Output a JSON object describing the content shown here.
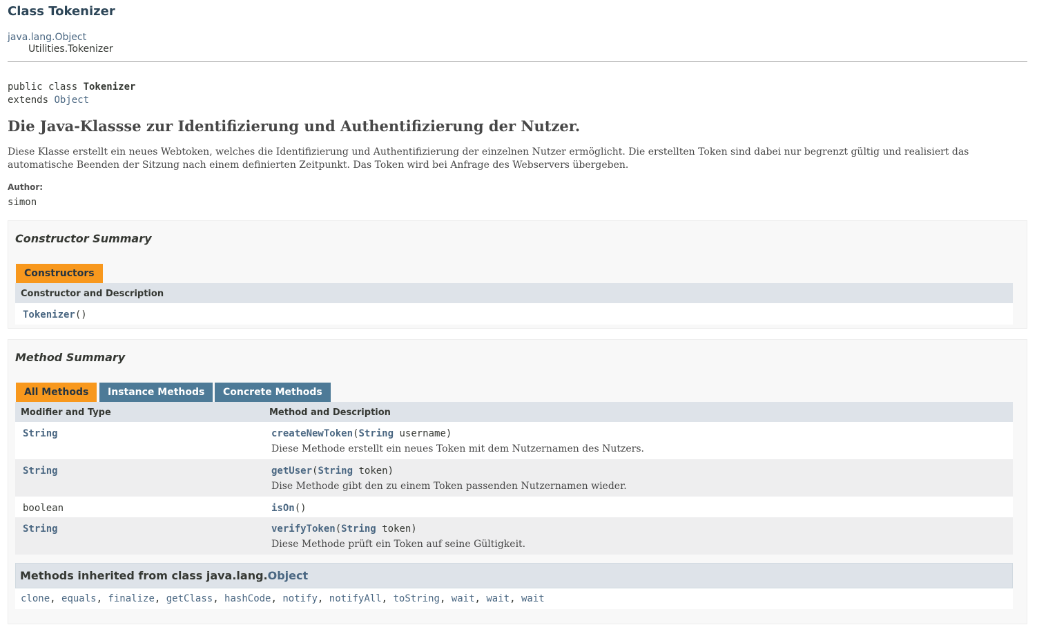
{
  "header": {
    "title": "Class Tokenizer",
    "inheritance_root": "java.lang.Object",
    "inheritance_child": "Utilities.Tokenizer"
  },
  "declaration": {
    "line1_prefix": "public class ",
    "class_name": "Tokenizer",
    "line2_prefix": "extends ",
    "superclass": "Object"
  },
  "description": {
    "heading": "Die Java-Klassse zur Identifizierung und Authentifizierung der Nutzer.",
    "body": "Diese Klasse erstellt ein neues Webtoken, welches die Identifizierung und Authentifizierung der einzelnen Nutzer ermöglicht. Die erstellten Token sind dabei nur begrenzt gültig und realisiert das automatische Beenden der Sitzung nach einem definierten Zeitpunkt. Das Token wird bei Anfrage des Webservers übergeben.",
    "author_label": "Author:",
    "author_value": "simon"
  },
  "constructor_summary": {
    "title": "Constructor Summary",
    "tab": "Constructors",
    "column": "Constructor and Description",
    "rows": [
      {
        "name": "Tokenizer",
        "params": "()"
      }
    ]
  },
  "method_summary": {
    "title": "Method Summary",
    "tabs": [
      {
        "label": "All Methods",
        "active": true
      },
      {
        "label": "Instance Methods",
        "active": false
      },
      {
        "label": "Concrete Methods",
        "active": false
      }
    ],
    "columns": [
      "Modifier and Type",
      "Method and Description"
    ],
    "rows": [
      {
        "type": "String",
        "name": "createNewToken",
        "open": "(",
        "param_type": "String",
        "param_rest": " username)",
        "desc": "Diese Methode erstellt ein neues Token mit dem Nutzernamen des Nutzers."
      },
      {
        "type": "String",
        "name": "getUser",
        "open": "(",
        "param_type": "String",
        "param_rest": " token)",
        "desc": "Dise Methode gibt den zu einem Token passenden Nutzernamen wieder."
      },
      {
        "type": "boolean",
        "name": "isOn",
        "params": "()"
      },
      {
        "type": "String",
        "name": "verifyToken",
        "open": "(",
        "param_type": "String",
        "param_rest": " token)",
        "desc": "Diese Methode prüft ein Token auf seine Gültigkeit."
      }
    ]
  },
  "inherited": {
    "prefix": "Methods inherited from class java.lang.",
    "class_link": "Object",
    "sep": ", ",
    "methods": [
      "clone",
      "equals",
      "finalize",
      "getClass",
      "hashCode",
      "notify",
      "notifyAll",
      "toString",
      "wait",
      "wait",
      "wait"
    ]
  },
  "colors": {
    "link": "#4a6782",
    "tab_active": "#f8981d",
    "tab_inactive": "#4d7a97",
    "table_header": "#dee3e9",
    "row_alt": "#eeeeef",
    "title": "#2c4557"
  }
}
